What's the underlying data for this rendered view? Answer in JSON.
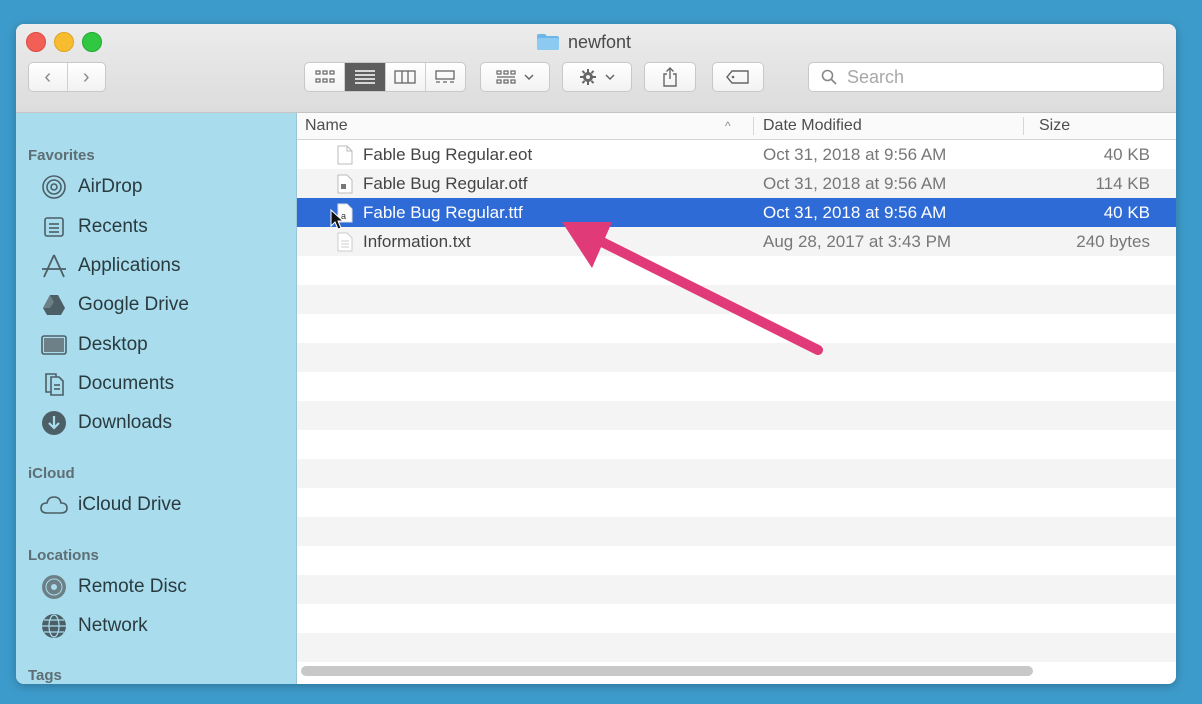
{
  "window": {
    "title": "newfont",
    "accent": "#2f6bd6"
  },
  "toolbar": {
    "back_glyph": "‹",
    "forward_glyph": "›",
    "view_modes": [
      "icon-view",
      "list-view",
      "column-view",
      "gallery-view"
    ],
    "active_view": "list-view",
    "search_placeholder": "Search"
  },
  "sidebar": {
    "sections": {
      "favorites": "Favorites",
      "icloud": "iCloud",
      "locations": "Locations",
      "tags": "Tags"
    },
    "favorites": [
      {
        "label": "AirDrop",
        "icon": "airdrop-icon"
      },
      {
        "label": "Recents",
        "icon": "recents-icon"
      },
      {
        "label": "Applications",
        "icon": "applications-icon"
      },
      {
        "label": "Google Drive",
        "icon": "google-drive-icon"
      },
      {
        "label": "Desktop",
        "icon": "desktop-icon"
      },
      {
        "label": "Documents",
        "icon": "documents-icon"
      },
      {
        "label": "Downloads",
        "icon": "downloads-icon"
      }
    ],
    "icloud": [
      {
        "label": "iCloud Drive",
        "icon": "cloud-icon"
      }
    ],
    "locations": [
      {
        "label": "Remote Disc",
        "icon": "disc-icon"
      },
      {
        "label": "Network",
        "icon": "network-icon"
      }
    ]
  },
  "columns": {
    "name": "Name",
    "date": "Date Modified",
    "size": "Size"
  },
  "files": [
    {
      "name": "Fable Bug Regular.eot",
      "date": "Oct 31, 2018 at 9:56 AM",
      "size": "40 KB",
      "selected": false
    },
    {
      "name": "Fable Bug Regular.otf",
      "date": "Oct 31, 2018 at 9:56 AM",
      "size": "114 KB",
      "selected": false
    },
    {
      "name": "Fable Bug Regular.ttf",
      "date": "Oct 31, 2018 at 9:56 AM",
      "size": "40 KB",
      "selected": true
    },
    {
      "name": "Information.txt",
      "date": "Aug 28, 2017 at 3:43 PM",
      "size": "240 bytes",
      "selected": false
    }
  ],
  "annotation": {
    "color": "#e03a78"
  }
}
